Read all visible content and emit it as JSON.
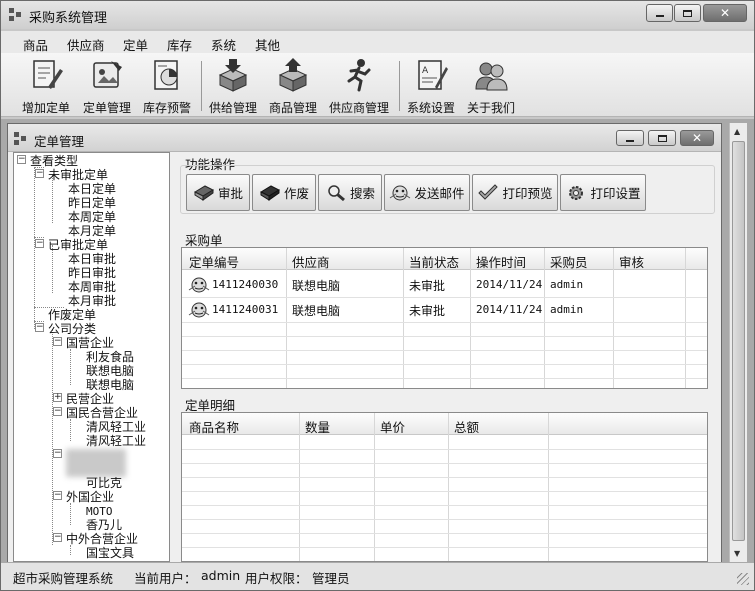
{
  "window": {
    "title": "采购系统管理"
  },
  "menu": [
    "商品",
    "供应商",
    "定单",
    "库存",
    "系统",
    "其他"
  ],
  "toolbar": [
    {
      "label": "增加定单",
      "icon": "pencil-paper-icon"
    },
    {
      "label": "定单管理",
      "icon": "order-manage-icon"
    },
    {
      "label": "库存预警",
      "icon": "chart-report-icon"
    },
    {
      "label": "供给管理",
      "icon": "box-download-icon"
    },
    {
      "label": "商品管理",
      "icon": "box-upload-icon"
    },
    {
      "label": "供应商管理",
      "icon": "runner-icon"
    },
    {
      "label": "系统设置",
      "icon": "settings-document-icon"
    },
    {
      "label": "关于我们",
      "icon": "users-icon"
    }
  ],
  "child": {
    "title": "定单管理"
  },
  "tree": {
    "root": "查看类型",
    "unapproved": {
      "label": "未审批定单",
      "children": [
        "本日定单",
        "昨日定单",
        "本周定单",
        "本月定单"
      ]
    },
    "approved": {
      "label": "已审批定单",
      "children": [
        "本日审批",
        "昨日审批",
        "本周审批",
        "本月审批"
      ]
    },
    "voided": "作废定单",
    "companies": {
      "label": "公司分类",
      "state_owned": {
        "label": "国营企业",
        "children": [
          "利友食品",
          "联想电脑",
          "联想电脑"
        ]
      },
      "private": {
        "label": "民营企业"
      },
      "mixed": {
        "label": "国民合营企业",
        "children": [
          "清风轻工业",
          "清风轻工业"
        ]
      },
      "hidden_child": "可比克",
      "foreign": {
        "label": "外国企业",
        "children": [
          "MOTO",
          "香乃儿"
        ]
      },
      "joint": {
        "label": "中外合营企业",
        "children": [
          "国宝文具"
        ]
      }
    }
  },
  "operations": {
    "title": "功能操作",
    "buttons": [
      {
        "label": "审批",
        "icon": "book-icon"
      },
      {
        "label": "作废",
        "icon": "void-book-icon"
      },
      {
        "label": "搜索",
        "icon": "magnifier-icon"
      },
      {
        "label": "发送邮件",
        "icon": "mail-icon"
      },
      {
        "label": "打印预览",
        "icon": "checkmark-icon"
      },
      {
        "label": "打印设置",
        "icon": "gear-icon"
      }
    ]
  },
  "orders": {
    "title": "采购单",
    "columns": [
      "定单编号",
      "供应商",
      "当前状态",
      "操作时间",
      "采购员",
      "审核"
    ],
    "rows": [
      {
        "id": "1411240030",
        "supplier": "联想电脑",
        "status": "未审批",
        "time": "2014/11/24",
        "buyer": "admin",
        "review": ""
      },
      {
        "id": "1411240031",
        "supplier": "联想电脑",
        "status": "未审批",
        "time": "2014/11/24",
        "buyer": "admin",
        "review": ""
      }
    ]
  },
  "details": {
    "title": "定单明细",
    "columns": [
      "商品名称",
      "数量",
      "单价",
      "总额"
    ]
  },
  "status": {
    "system": "超市采购管理系统",
    "user_label": "当前用户：",
    "user": "admin",
    "perm_label": "用户权限：",
    "perm": "管理员"
  }
}
